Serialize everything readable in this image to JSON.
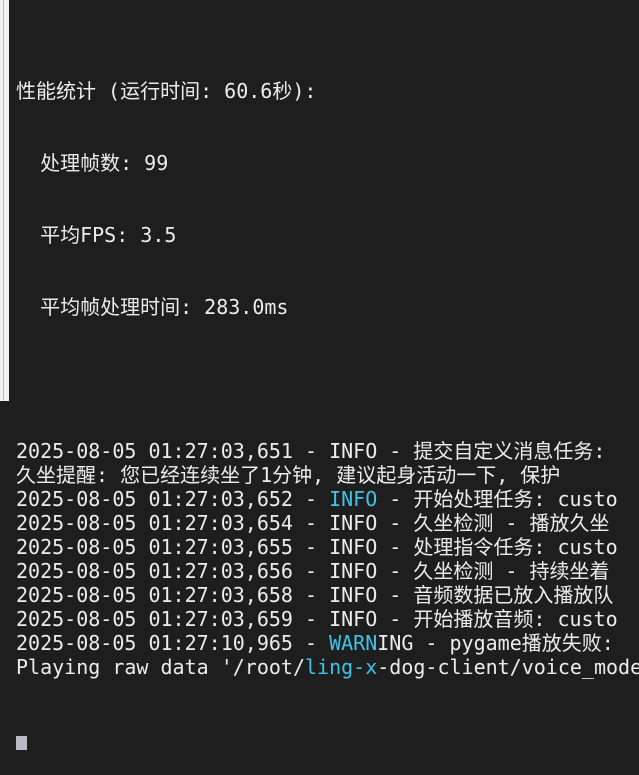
{
  "stats": {
    "header": "性能统计 (运行时间: 60.6秒):",
    "frames": "  处理帧数: 99",
    "fps": "  平均FPS: 3.5",
    "avg_time": "  平均帧处理时间: 283.0ms"
  },
  "log": [
    {
      "pre": "2025-08-05 01:27:03,651 - ",
      "hl": "",
      "post": "INFO - 提交自定义消息任务: "
    },
    {
      "pre": "久坐提醒: 您已经连续坐了1分钟, 建议起身活动一下, 保护",
      "hl": "",
      "post": ""
    },
    {
      "pre": "2025-08-05 01:27:03,652 - ",
      "hl": "INFO",
      "post": " - 开始处理任务: custo"
    },
    {
      "pre": "2025-08-05 01:27:03,654 - ",
      "hl": "",
      "post": "INFO - 久坐检测 - 播放久坐"
    },
    {
      "pre": "2025-08-05 01:27:03,655 - ",
      "hl": "",
      "post": "INFO - 处理指令任务: custo"
    },
    {
      "pre": "2025-08-05 01:27:03,656 - ",
      "hl": "",
      "post": "INFO - 久坐检测 - 持续坐着"
    },
    {
      "pre": "2025-08-05 01:27:03,658 - ",
      "hl": "",
      "post": "INFO - 音频数据已放入播放队"
    },
    {
      "pre": "2025-08-05 01:27:03,659 - ",
      "hl": "",
      "post": "INFO - 开始播放音频: custo"
    },
    {
      "pre": "2025-08-05 01:27:10,965 - ",
      "hl": "WARN",
      "post": "ING - pygame播放失败: "
    },
    {
      "pre": "Playing raw data '/root/",
      "hl": "ling-x",
      "post": "-dog-client/voice_mode"
    }
  ],
  "colors": {
    "background": "#1e1e1e",
    "text": "#ececec",
    "highlight": "#3fc4e8"
  }
}
